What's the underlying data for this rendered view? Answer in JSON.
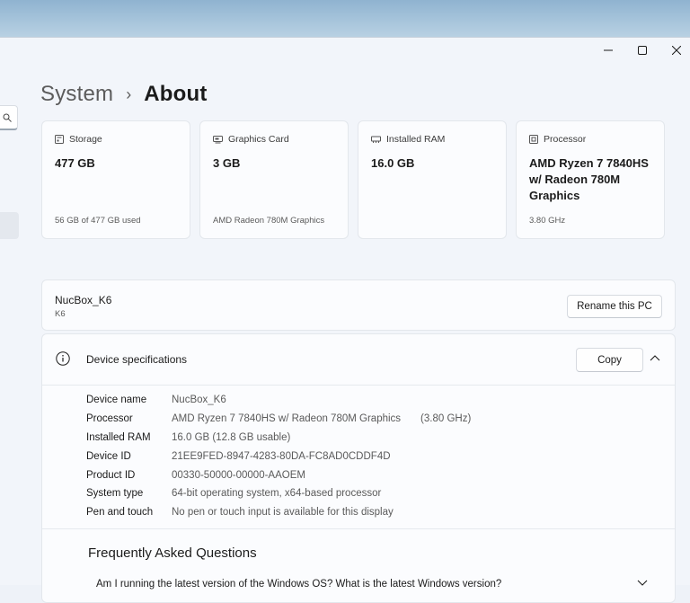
{
  "breadcrumb": {
    "parent": "System",
    "current": "About"
  },
  "cards": [
    {
      "icon": "storage-icon",
      "label": "Storage",
      "value": "477 GB",
      "sub": "56 GB of 477 GB used"
    },
    {
      "icon": "graphics-card-icon",
      "label": "Graphics Card",
      "value": "3 GB",
      "sub": "AMD Radeon 780M Graphics"
    },
    {
      "icon": "ram-icon",
      "label": "Installed RAM",
      "value": "16.0 GB",
      "sub": ""
    },
    {
      "icon": "processor-icon",
      "label": "Processor",
      "value": "AMD Ryzen 7 7840HS w/ Radeon 780M Graphics",
      "sub": "3.80 GHz"
    }
  ],
  "pc": {
    "name": "NucBox_K6",
    "model": "K6",
    "rename_label": "Rename this PC"
  },
  "device_specs": {
    "title": "Device specifications",
    "copy_label": "Copy",
    "rows": [
      {
        "label": "Device name",
        "value": "NucBox_K6"
      },
      {
        "label": "Processor",
        "value": "AMD Ryzen 7 7840HS w/ Radeon 780M Graphics",
        "extra": "(3.80 GHz)"
      },
      {
        "label": "Installed RAM",
        "value": "16.0 GB (12.8 GB usable)"
      },
      {
        "label": "Device ID",
        "value": "21EE9FED-8947-4283-80DA-FC8AD0CDDF4D"
      },
      {
        "label": "Product ID",
        "value": "00330-50000-00000-AAOEM"
      },
      {
        "label": "System type",
        "value": "64-bit operating system, x64-based processor"
      },
      {
        "label": "Pen and touch",
        "value": "No pen or touch input is available for this display"
      }
    ]
  },
  "faq": {
    "title": "Frequently Asked Questions",
    "question": "Am I running the latest version of the Windows OS? What is the latest Windows version?"
  },
  "colors": {
    "window_bg": "#f2f5fa",
    "card_bg": "#fbfcfe",
    "border": "#e3e7ec"
  }
}
